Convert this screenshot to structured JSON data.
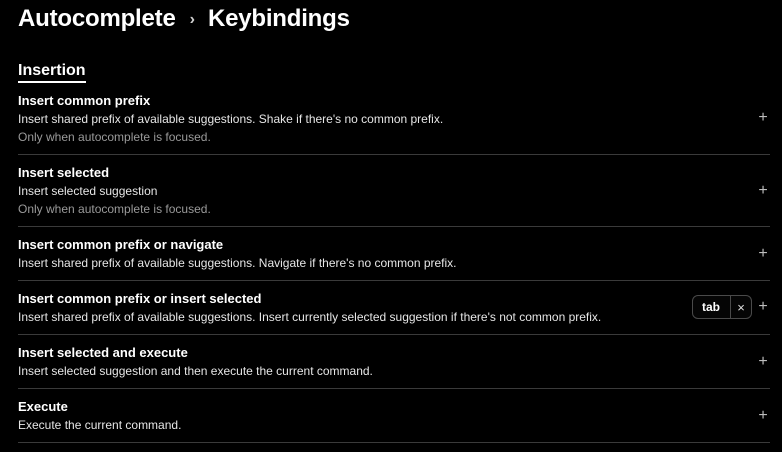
{
  "breadcrumb": {
    "parent": "Autocomplete",
    "separator": "›",
    "current": "Keybindings"
  },
  "section": {
    "title": "Insertion"
  },
  "rows": [
    {
      "title": "Insert common prefix",
      "description": "Insert shared prefix of available suggestions. Shake if there's no common prefix.",
      "note": "Only when autocomplete is focused."
    },
    {
      "title": "Insert selected",
      "description": "Insert selected suggestion",
      "note": "Only when autocomplete is focused."
    },
    {
      "title": "Insert common prefix or navigate",
      "description": "Insert shared prefix of available suggestions. Navigate if there's no common prefix."
    },
    {
      "title": "Insert common prefix or insert selected",
      "description": "Insert shared prefix of available suggestions. Insert currently selected suggestion if there's not common prefix.",
      "binding": {
        "key": "tab",
        "remove_icon": "×"
      }
    },
    {
      "title": "Insert selected and execute",
      "description": "Insert selected suggestion and then execute the current command."
    },
    {
      "title": "Execute",
      "description": "Execute the current command."
    }
  ],
  "icons": {
    "add": "+"
  },
  "colors": {
    "background": "#000000",
    "text": "#ffffff",
    "muted": "#9a9a9a",
    "divider": "#3a3a3a"
  }
}
